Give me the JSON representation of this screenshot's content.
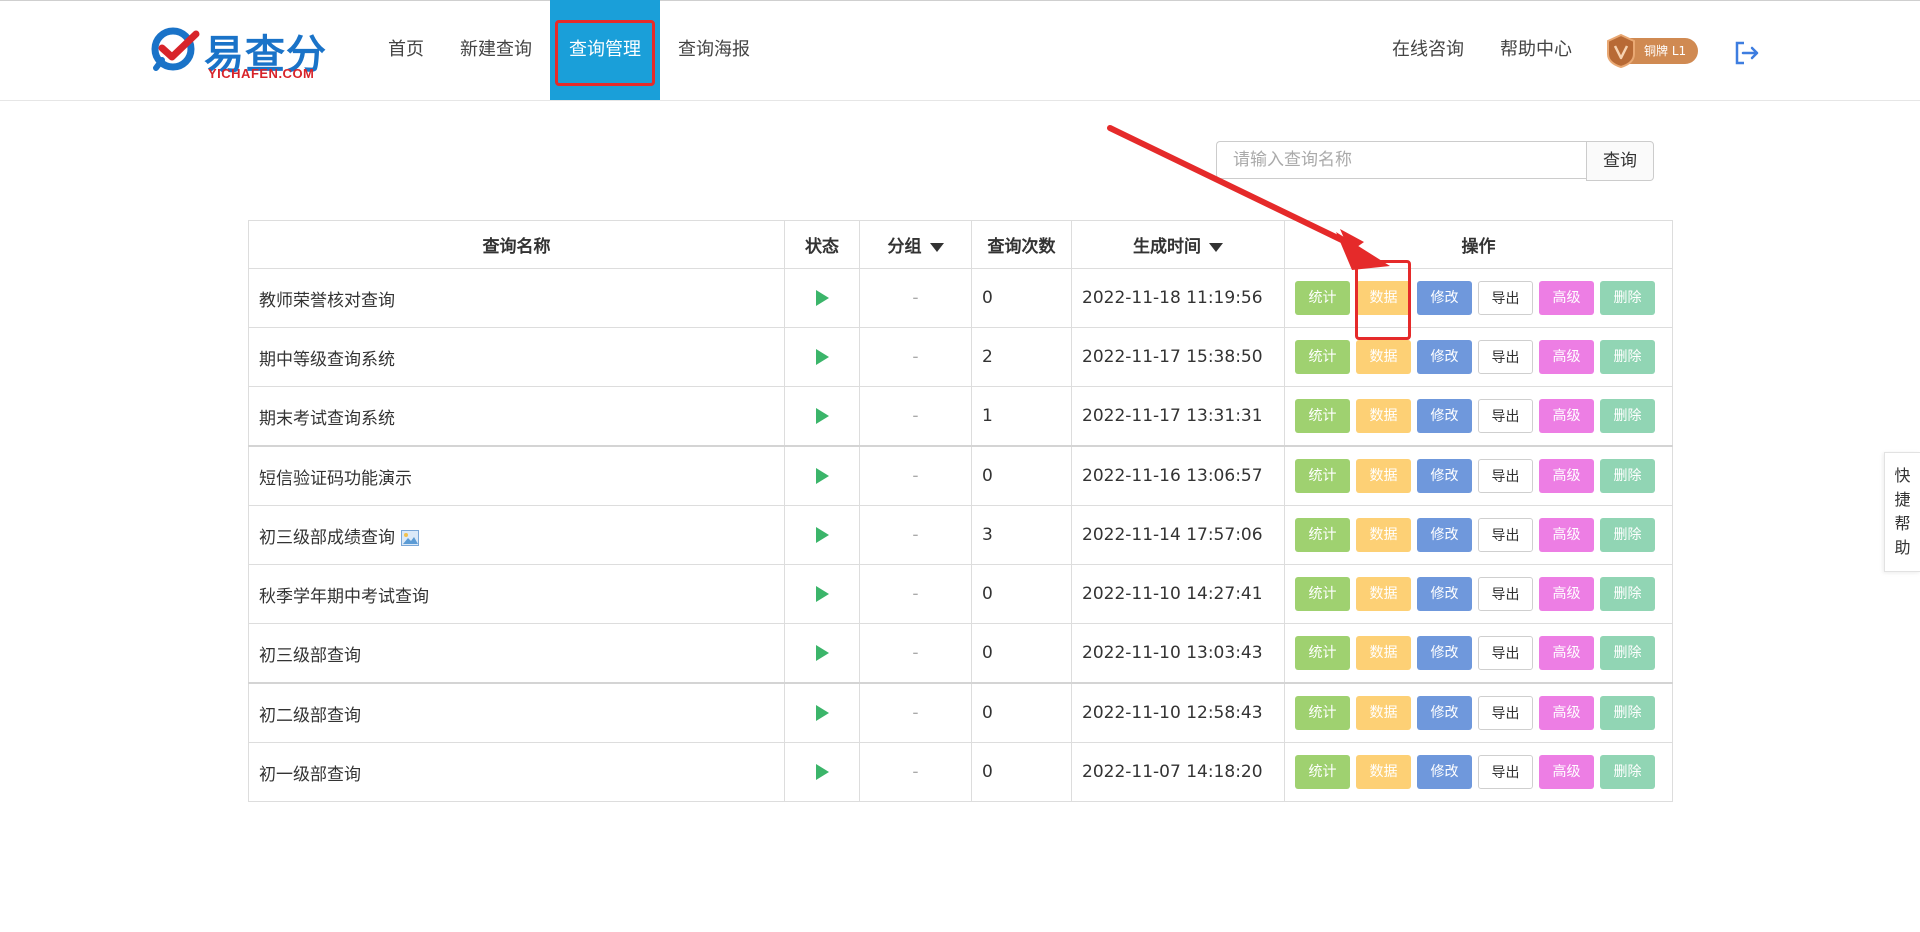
{
  "brand": {
    "name_cn": "易查分",
    "name_en": "YICHAFEN.COM"
  },
  "nav": {
    "items": [
      {
        "label": "首页"
      },
      {
        "label": "新建查询"
      },
      {
        "label": "查询管理"
      },
      {
        "label": "查询海报"
      }
    ]
  },
  "header_right": {
    "consult": "在线咨询",
    "help": "帮助中心",
    "badge": "铜牌 L1"
  },
  "search": {
    "placeholder": "请输入查询名称",
    "button": "查询"
  },
  "table": {
    "headers": {
      "name": "查询名称",
      "status": "状态",
      "group": "分组",
      "count": "查询次数",
      "time": "生成时间",
      "ops": "操作"
    },
    "op_labels": {
      "stat": "统计",
      "data": "数据",
      "edit": "修改",
      "export": "导出",
      "advanced": "高级",
      "delete": "删除"
    },
    "rows": [
      {
        "name": "教师荣誉核对查询",
        "group": "-",
        "count": "0",
        "time": "2022-11-18 11:19:56"
      },
      {
        "name": "期中等级查询系统",
        "group": "-",
        "count": "2",
        "time": "2022-11-17 15:38:50"
      },
      {
        "name": "期末考试查询系统",
        "group": "-",
        "count": "1",
        "time": "2022-11-17 13:31:31"
      },
      {
        "name": "短信验证码功能演示",
        "group": "-",
        "count": "0",
        "time": "2022-11-16 13:06:57"
      },
      {
        "name": "初三级部成绩查询",
        "group": "-",
        "count": "3",
        "time": "2022-11-14 17:57:06"
      },
      {
        "name": "秋季学年期中考试查询",
        "group": "-",
        "count": "0",
        "time": "2022-11-10 14:27:41"
      },
      {
        "name": "初三级部查询",
        "group": "-",
        "count": "0",
        "time": "2022-11-10 13:03:43"
      },
      {
        "name": "初二级部查询",
        "group": "-",
        "count": "0",
        "time": "2022-11-10 12:58:43"
      },
      {
        "name": "初一级部查询",
        "group": "-",
        "count": "0",
        "time": "2022-11-07 14:18:20"
      }
    ]
  },
  "quick_help": {
    "c1": "快",
    "c2": "捷",
    "c3": "帮",
    "c4": "助"
  },
  "colors": {
    "nav_active": "#1a9fd9",
    "annotation": "#e52a2a",
    "play": "#3bb56a",
    "op_stat": "#9fd170",
    "op_data": "#fdd075",
    "op_edit": "#6f98dc",
    "op_advanced": "#ed7ee4",
    "op_delete": "#91d5b4"
  }
}
